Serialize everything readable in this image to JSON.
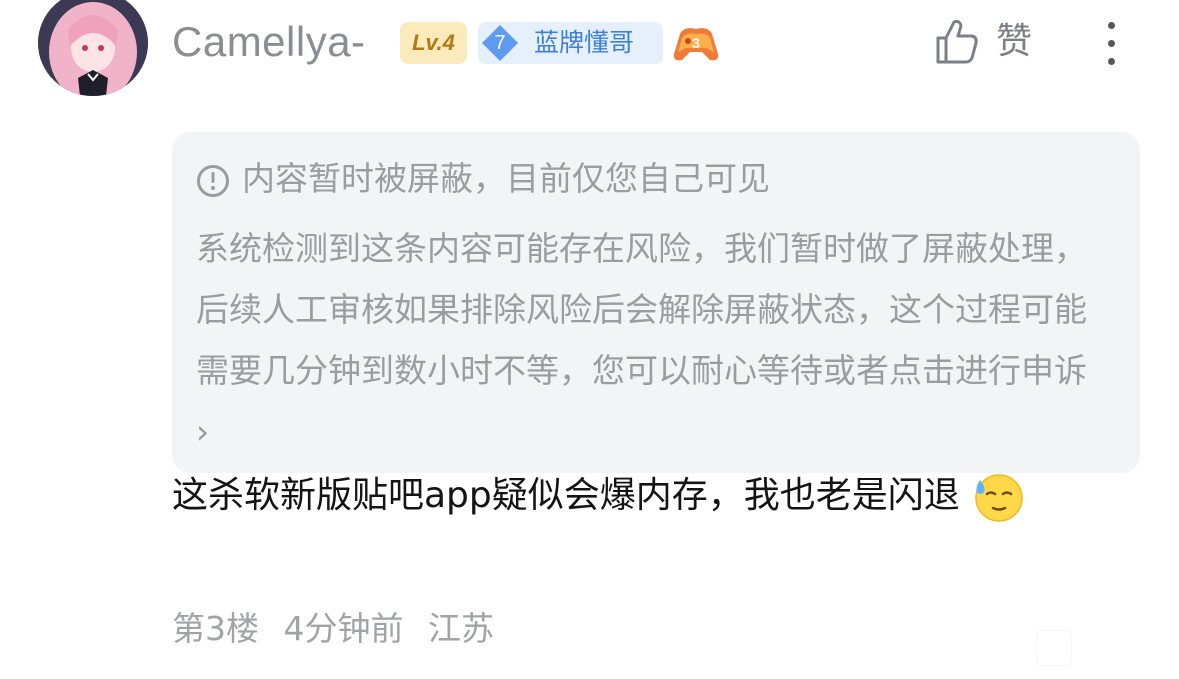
{
  "post": {
    "username": "Camellya-",
    "level_badge": "Lv.4",
    "fan_badge_level": "7",
    "fan_badge_label": "蓝牌懂哥",
    "like_label": "赞"
  },
  "notice": {
    "title": "内容暂时被屏蔽，目前仅您自己可见",
    "body": "系统检测到这条内容可能存在风险，我们暂时做了屏蔽处理，后续人工审核如果排除风险后会解除屏蔽状态，这个过程可能需要几分钟到数小时不等，您可以耐心等待或者点击进行申诉",
    "appeal_chevron": "›"
  },
  "comment": {
    "text": "这杀软新版贴吧app疑似会爆内存，我也老是闪退"
  },
  "meta": {
    "floor": "第3楼",
    "time": "4分钟前",
    "location": "江苏"
  },
  "colors": {
    "level_bg": "#fbeabc",
    "level_text": "#b27a10",
    "fan_bg": "#e6f0fc",
    "fan_text": "#3e7fd9",
    "notice_bg": "#f3f4f6",
    "muted_text": "#9a9ca2"
  },
  "icons": {
    "avatar": "anime-girl-avatar",
    "game_badge": "gamepad-icon",
    "like": "thumbs-up-icon",
    "more": "vertical-ellipsis-icon",
    "info": "info-circle-icon",
    "emoji": "sweat-smile-emoji"
  }
}
